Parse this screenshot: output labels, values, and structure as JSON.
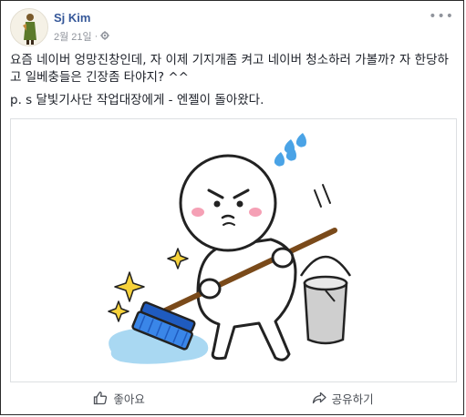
{
  "post": {
    "author": "Sj Kim",
    "date": "2월 21일",
    "separator": "·",
    "privacy_icon": "gear-icon",
    "menu_icon": "more-options-icon",
    "text_line1": "요즘 네이버 엉망진창인데, 자 이제 기지개좀 켜고 네이버 청소하러 가볼까? 자 한당하고 일베충들은 긴장좀 타야지? ^^",
    "text_line2": "p. s 달빛기사단 작업대장에게 - 엔젤이 돌아왔다.",
    "image_description_icon": "cleaning-character-sticker"
  },
  "actions": {
    "like_label": "좋아요",
    "like_icon": "thumbs-up-icon",
    "share_label": "공유하기",
    "share_icon": "share-arrow-icon"
  },
  "colors": {
    "author_link": "#365899",
    "meta_gray": "#90949c",
    "action_gray": "#4b4f56",
    "mop_blue": "#2f6fd6"
  }
}
